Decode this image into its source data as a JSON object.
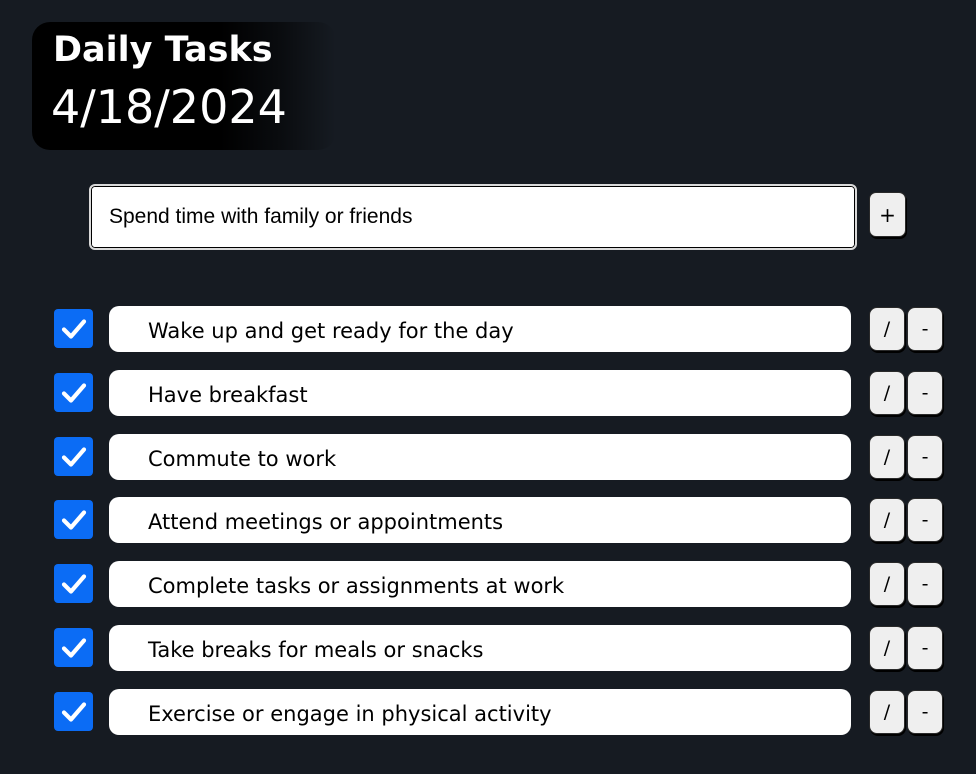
{
  "header": {
    "title": "Daily Tasks",
    "date": "4/18/2024"
  },
  "new_task": {
    "value": "Spend time with family or friends",
    "add_label": "+"
  },
  "tasks": [
    {
      "label": "Wake up and get ready for the day",
      "checked": true,
      "edit_label": "/",
      "remove_label": "-"
    },
    {
      "label": "Have breakfast",
      "checked": true,
      "edit_label": "/",
      "remove_label": "-"
    },
    {
      "label": "Commute to work",
      "checked": true,
      "edit_label": "/",
      "remove_label": "-"
    },
    {
      "label": "Attend meetings or appointments",
      "checked": true,
      "edit_label": "/",
      "remove_label": "-"
    },
    {
      "label": "Complete tasks or assignments at work",
      "checked": true,
      "edit_label": "/",
      "remove_label": "-"
    },
    {
      "label": "Take breaks for meals or snacks",
      "checked": true,
      "edit_label": "/",
      "remove_label": "-"
    },
    {
      "label": "Exercise or engage in physical activity",
      "checked": true,
      "edit_label": "/",
      "remove_label": "-"
    }
  ],
  "colors": {
    "page_background": "#161b22",
    "header_background": "#000000",
    "checkbox_accent": "#0b6cf5",
    "task_background": "#ffffff",
    "button_background": "#efefef"
  },
  "icons": {
    "checkbox": "checkmark-icon"
  }
}
